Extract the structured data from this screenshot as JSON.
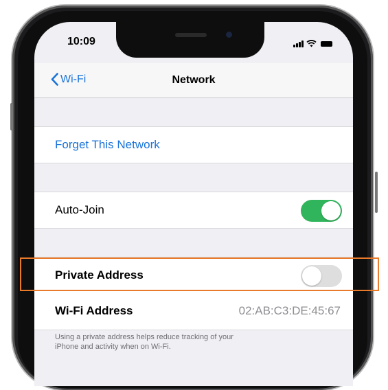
{
  "status_bar": {
    "time": "10:09"
  },
  "nav": {
    "back_label": "Wi-Fi",
    "title": "Network"
  },
  "forget": {
    "label": "Forget This Network"
  },
  "auto_join": {
    "label": "Auto-Join",
    "enabled": true
  },
  "private_address": {
    "label": "Private Address",
    "enabled": false
  },
  "wifi_address": {
    "label": "Wi-Fi Address",
    "value": "02:AB:C3:DE:45:67"
  },
  "footer": {
    "line1": "Using a private address helps reduce tracking of your",
    "line2": "iPhone and activity when on Wi-Fi."
  },
  "colors": {
    "accent": "#1a73d9",
    "toggle_on": "#31b55c",
    "highlight": "#e87a2a"
  },
  "icons": {
    "back": "chevron-left-icon",
    "signal": "cellular-signal-icon",
    "wifi": "wifi-icon",
    "battery": "battery-icon"
  }
}
